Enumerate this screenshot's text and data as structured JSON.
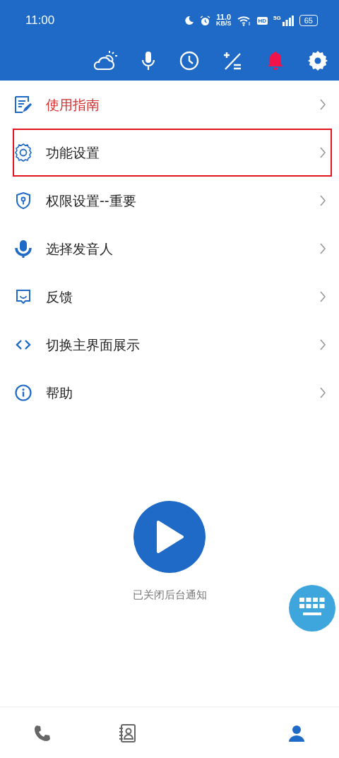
{
  "status_bar": {
    "time": "11:00",
    "speed": "11.0",
    "speed_unit": "KB/S",
    "hd": "HD",
    "network": "5G",
    "battery": "65"
  },
  "toolbar": {
    "notifications_on": true
  },
  "menu": [
    {
      "label": "使用指南",
      "emphasized": true,
      "highlighted": false
    },
    {
      "label": "功能设置",
      "emphasized": false,
      "highlighted": true
    },
    {
      "label": "权限设置--重要",
      "emphasized": false,
      "highlighted": false
    },
    {
      "label": "选择发音人",
      "emphasized": false,
      "highlighted": false
    },
    {
      "label": "反馈",
      "emphasized": false,
      "highlighted": false
    },
    {
      "label": "切换主界面展示",
      "emphasized": false,
      "highlighted": false
    },
    {
      "label": "帮助",
      "emphasized": false,
      "highlighted": false
    }
  ],
  "status_text": "已关闭后台通知",
  "bottom_nav": [
    {
      "selected": false
    },
    {
      "selected": false
    },
    {
      "selected": true
    }
  ]
}
